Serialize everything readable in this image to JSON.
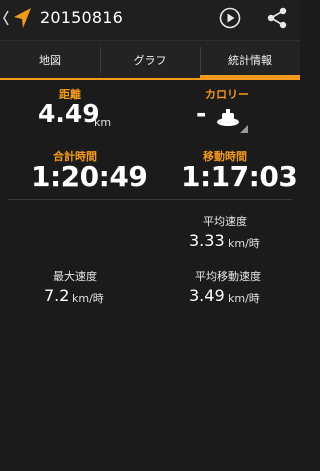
{
  "header": {
    "title": "20150816"
  },
  "tabs": [
    {
      "label": "地図"
    },
    {
      "label": "グラフ"
    },
    {
      "label": "統計情報"
    }
  ],
  "stats": {
    "distance": {
      "label": "距離",
      "value": "4.49",
      "unit": "km"
    },
    "calories": {
      "label": "カロリー",
      "value": "-"
    },
    "total_time": {
      "label": "合計時間",
      "value": "1:20:49"
    },
    "moving_time": {
      "label": "移動時間",
      "value": "1:17:03"
    },
    "avg_speed": {
      "label": "平均速度",
      "value": "3.33",
      "unit": "km/時"
    },
    "max_speed": {
      "label": "最大速度",
      "value": "7.2",
      "unit": "km/時"
    },
    "avg_moving_speed": {
      "label": "平均移動速度",
      "value": "3.49",
      "unit": "km/時"
    }
  },
  "colors": {
    "accent": "#f39a1c",
    "background": "#1b1b1b"
  },
  "icons": [
    "back-chevron-icon",
    "navigation-arrow-icon",
    "play-icon",
    "share-icon",
    "activity-type-icon"
  ]
}
